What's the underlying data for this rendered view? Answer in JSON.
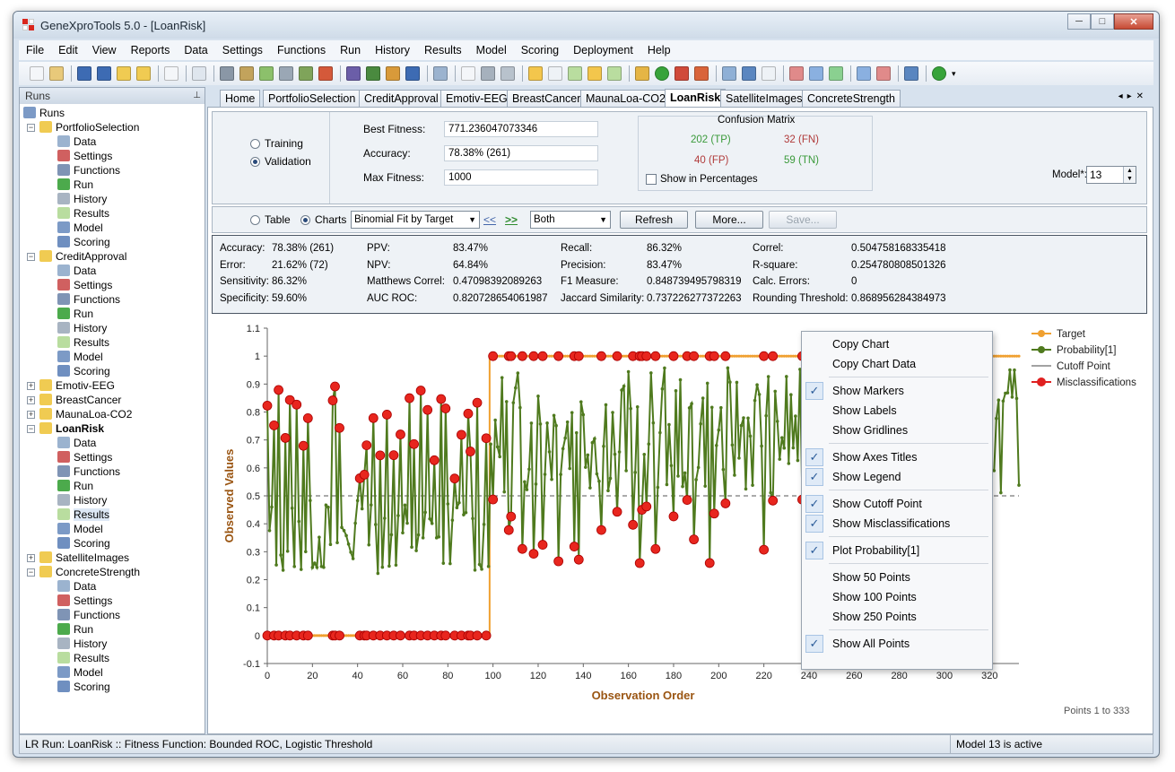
{
  "window": {
    "title": "GeneXproTools 5.0 - [LoanRisk]",
    "buttons": [
      "─",
      "□",
      "✕"
    ]
  },
  "menu": [
    "File",
    "Edit",
    "View",
    "Reports",
    "Data",
    "Settings",
    "Functions",
    "Run",
    "History",
    "Results",
    "Model",
    "Scoring",
    "Deployment",
    "Help"
  ],
  "sidebar": {
    "title": "Runs",
    "root": "Runs",
    "subitems": [
      "Data",
      "Settings",
      "Functions",
      "Run",
      "History",
      "Results",
      "Model",
      "Scoring"
    ],
    "projects": [
      "PortfolioSelection",
      "CreditApproval",
      "Emotiv-EEG",
      "BreastCancer",
      "MaunaLoa-CO2",
      "LoanRisk",
      "SatelliteImages",
      "ConcreteStrength"
    ]
  },
  "tabs": [
    "Home",
    "PortfolioSelection",
    "CreditApproval",
    "Emotiv-EEG",
    "BreastCancer",
    "MaunaLoa-CO2",
    "LoanRisk",
    "SatelliteImages",
    "ConcreteStrength"
  ],
  "active_tab": "LoanRisk",
  "top_panel": {
    "mode_training": "Training",
    "mode_validation": "Validation",
    "best_fitness_label": "Best Fitness:",
    "best_fitness": "771.236047073346",
    "accuracy_label": "Accuracy:",
    "accuracy": "78.38% (261)",
    "max_fitness_label": "Max Fitness:",
    "max_fitness": "1000",
    "confusion_title": "Confusion Matrix",
    "tp": "202 (TP)",
    "fn": "32 (FN)",
    "fp": "40 (FP)",
    "tn": "59 (TN)",
    "show_pct": "Show in Percentages",
    "model_label": "Model*:",
    "model_value": "13"
  },
  "controls": {
    "table": "Table",
    "charts": "Charts",
    "chart_type": "Binomial Fit by Target",
    "prev": "<<",
    "next": ">>",
    "subset": "Both",
    "refresh": "Refresh",
    "more": "More...",
    "save": "Save..."
  },
  "stats": [
    [
      "Accuracy:",
      "78.38% (261)",
      "PPV:",
      "83.47%",
      "Recall:",
      "86.32%",
      "Correl:",
      "0.504758168335418"
    ],
    [
      "Error:",
      "21.62% (72)",
      "NPV:",
      "64.84%",
      "Precision:",
      "83.47%",
      "R-square:",
      "0.254780808501326"
    ],
    [
      "Sensitivity:",
      "86.32%",
      "Matthews Correl:",
      "0.47098392089263",
      "F1 Measure:",
      "0.848739495798319",
      "Calc. Errors:",
      "0"
    ],
    [
      "Specificity:",
      "59.60%",
      "AUC ROC:",
      "0.820728654061987",
      "Jaccard Similarity:",
      "0.737226277372263",
      "Rounding Threshold:",
      "0.868956284384973"
    ]
  ],
  "chart_data": {
    "type": "line",
    "xlabel": "Observation Order",
    "ylabel": "Observed Values",
    "xlim": [
      0,
      333
    ],
    "ylim": [
      -0.1,
      1.1
    ],
    "x_ticks": [
      0,
      20,
      40,
      60,
      80,
      100,
      120,
      140,
      160,
      180,
      200,
      220,
      240,
      260,
      280,
      300,
      320
    ],
    "y_ticks": [
      "-0.1",
      "0",
      "0.1",
      "0.2",
      "0.3",
      "0.4",
      "0.5",
      "0.6",
      "0.7",
      "0.8",
      "0.9",
      "1",
      "1.1"
    ],
    "cutoff": 0.5,
    "grid": false,
    "legend_position": "right",
    "series": [
      {
        "name": "Target",
        "color": "#f0a030",
        "description": "0 for observations 1-98, 1 for observations 99-333"
      },
      {
        "name": "Probability[1]",
        "color": "#4f7a1e"
      },
      {
        "name": "Cutoff Point",
        "color": "#444444"
      },
      {
        "name": "Misclassifications",
        "color": "#e02020"
      }
    ],
    "misclassifications_at_0": [
      0,
      3,
      5,
      8,
      10,
      13,
      16,
      18,
      29,
      30,
      32,
      41,
      43,
      44,
      47,
      50,
      53,
      56,
      59,
      63,
      65,
      68,
      71,
      74,
      77,
      79,
      83,
      86,
      89,
      90,
      93,
      97
    ],
    "misclassifications_at_1": [
      100,
      107,
      108,
      113,
      118,
      122,
      129,
      136,
      138,
      148,
      155,
      162,
      165,
      166,
      168,
      172,
      180,
      186,
      189,
      196,
      198,
      203,
      220,
      224,
      237,
      243,
      249,
      269,
      290,
      300
    ],
    "points_caption": "Points 1 to 333"
  },
  "context_menu": [
    {
      "label": "Copy Chart",
      "checked": false
    },
    {
      "label": "Copy Chart Data",
      "checked": false
    },
    {
      "label": "Show Markers",
      "checked": true
    },
    {
      "label": "Show Labels",
      "checked": false
    },
    {
      "label": "Show Gridlines",
      "checked": false
    },
    {
      "label": "Show Axes Titles",
      "checked": true
    },
    {
      "label": "Show Legend",
      "checked": true
    },
    {
      "label": "Show Cutoff Point",
      "checked": true
    },
    {
      "label": "Show Misclassifications",
      "checked": true
    },
    {
      "label": "Plot Probability[1]",
      "checked": true
    },
    {
      "label": "Show 50 Points",
      "checked": false
    },
    {
      "label": "Show 100 Points",
      "checked": false
    },
    {
      "label": "Show 250 Points",
      "checked": false
    },
    {
      "label": "Show All Points",
      "checked": true
    }
  ],
  "status": {
    "left": "LR Run: LoanRisk :: Fitness Function: Bounded ROC, Logistic Threshold",
    "right": "Model 13 is active"
  }
}
